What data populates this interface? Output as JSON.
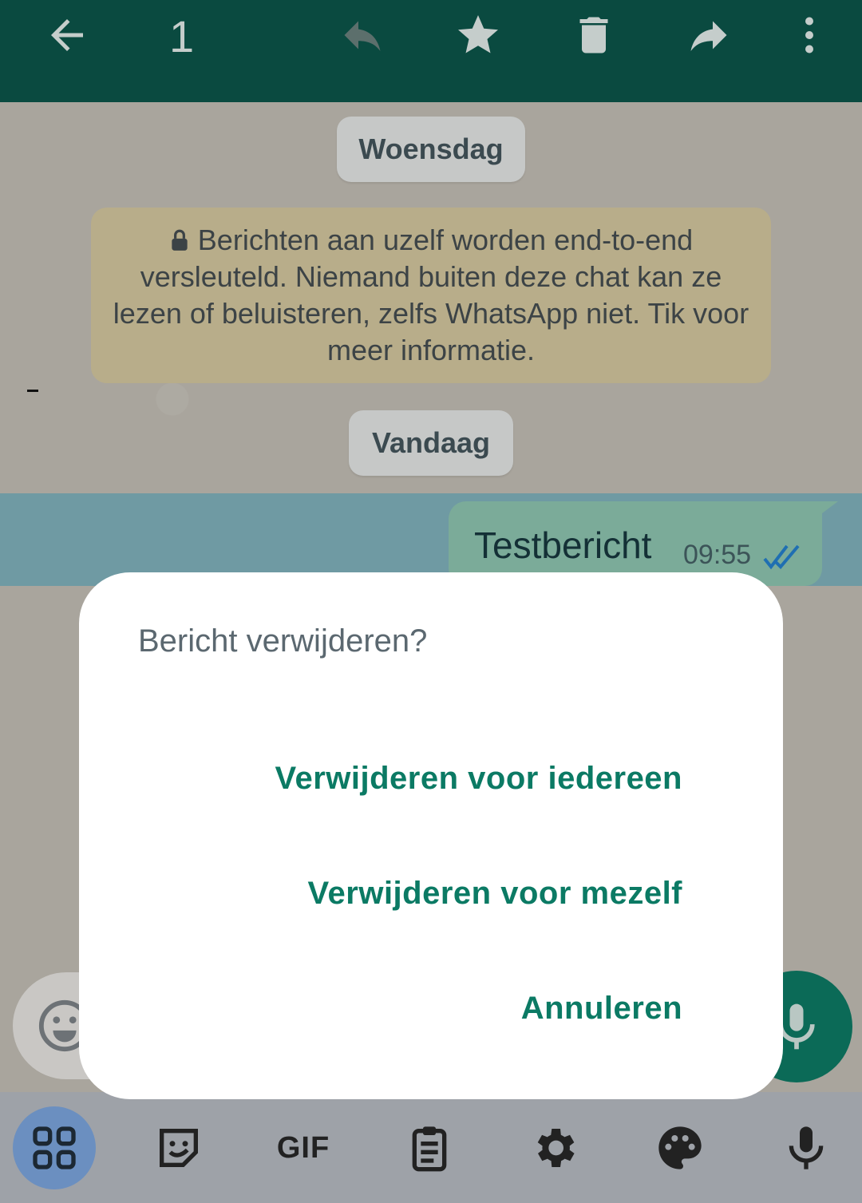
{
  "toolbar": {
    "selected_count": "1",
    "icons": [
      "back-arrow-icon",
      "reply-icon",
      "star-icon",
      "trash-icon",
      "forward-icon",
      "more-vert-icon"
    ]
  },
  "chat": {
    "date_wednesday": "Woensdag",
    "encryption_notice": "Berichten aan uzelf worden end-to-end versleuteld. Niemand buiten deze chat kan ze lezen of beluisteren, zelfs WhatsApp niet. Tik voor meer informatie.",
    "date_today": "Vandaag",
    "message": {
      "text": "Testbericht",
      "time": "09:55",
      "status": "read-double-tick"
    }
  },
  "dialog": {
    "title": "Bericht verwijderen?",
    "delete_for_everyone": "Verwijderen voor iedereen",
    "delete_for_me": "Verwijderen voor mezelf",
    "cancel": "Annuleren"
  },
  "keyboard_bar": {
    "gif_label": "GIF",
    "icons": [
      "apps-grid-icon",
      "sticker-icon",
      "gif-icon",
      "clipboard-icon",
      "settings-icon",
      "palette-icon",
      "mic-icon"
    ]
  },
  "colors": {
    "toolbar_bg": "#0a4a40",
    "accent": "#0b7a64",
    "bubble": "#7bab99",
    "selection": "#6f9aa3"
  }
}
